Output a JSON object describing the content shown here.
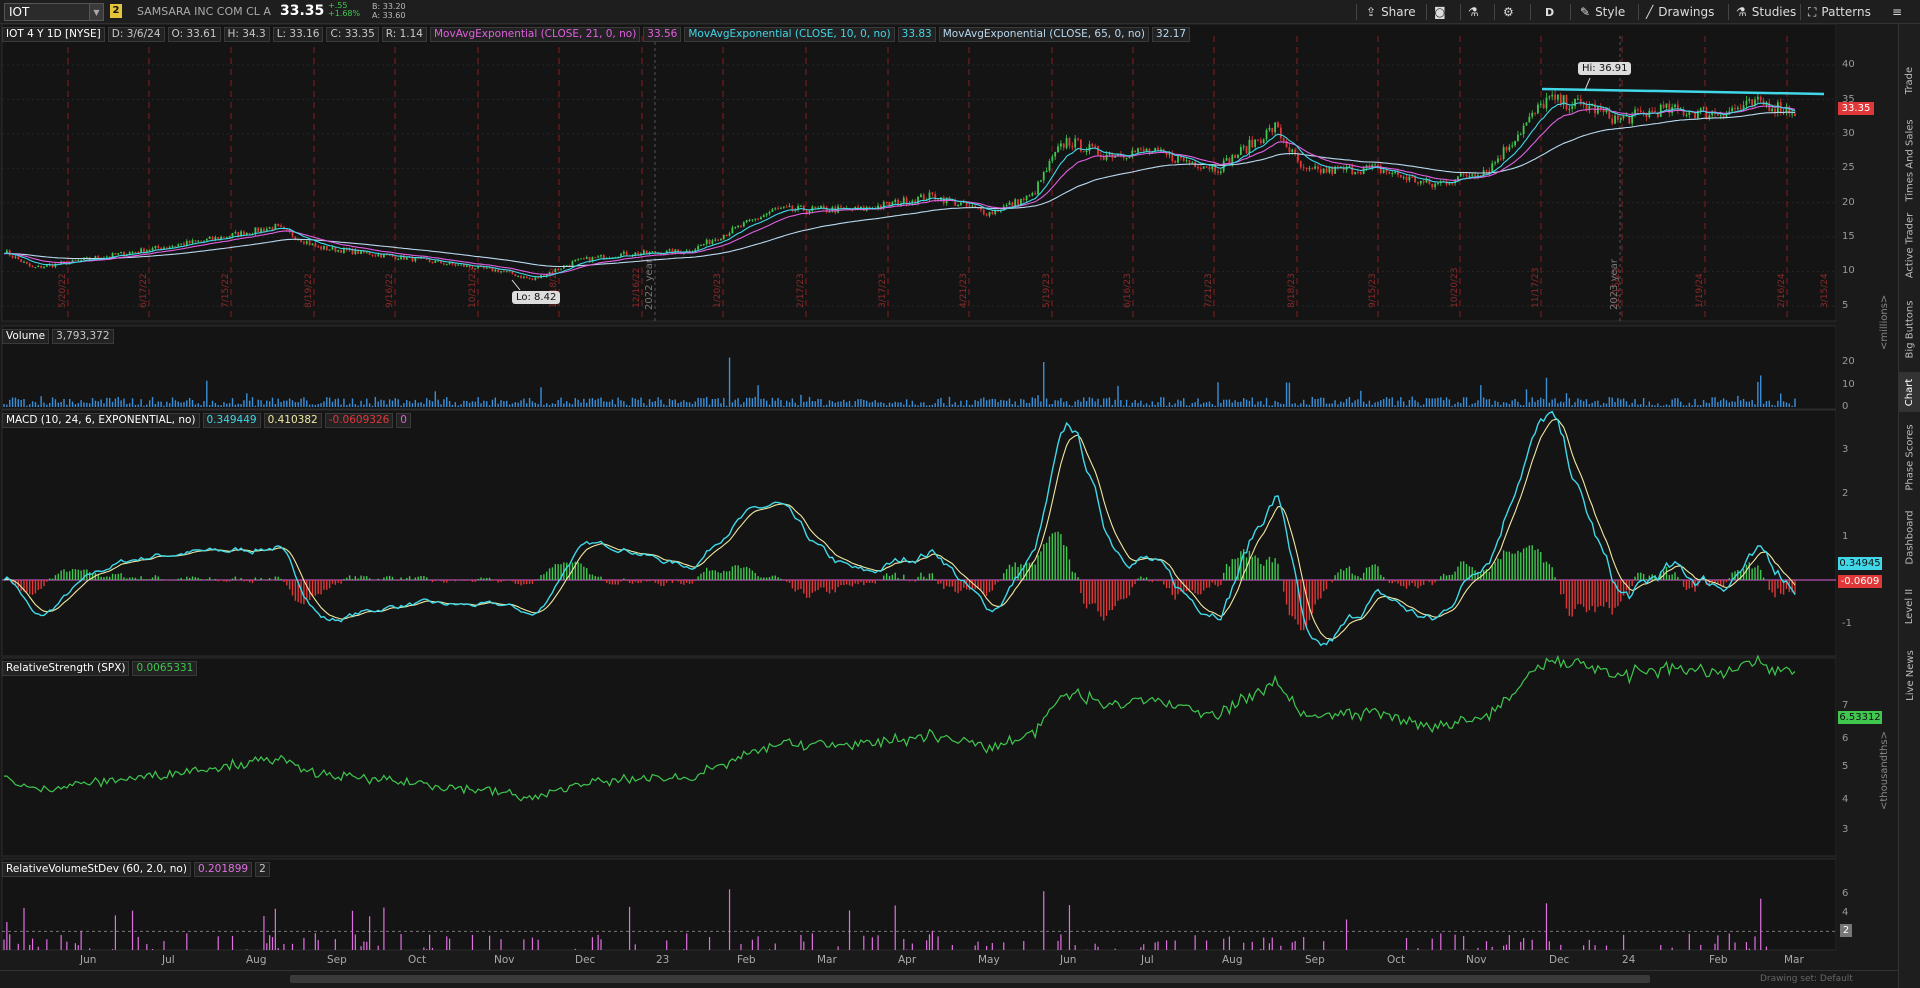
{
  "header": {
    "symbol": "IOT",
    "link_number": "2",
    "company": "SAMSARA INC COM CL A",
    "last": "33.35",
    "change": "+.55",
    "change_pct": "+1.68%",
    "bid": "B: 33.20",
    "ask": "A: 33.60",
    "timeframe": "D",
    "buttons": {
      "share": "Share",
      "style": "Style",
      "drawings": "Drawings",
      "studies": "Studies",
      "patterns": "Patterns"
    }
  },
  "side_tabs": [
    "Trade",
    "Times And Sales",
    "Active Trader",
    "Big Buttons",
    "Chart",
    "Phase Scores",
    "Dashboard",
    "Level II",
    "Live News"
  ],
  "price_panel": {
    "title": "IOT 4 Y 1D [NYSE]",
    "date": "D: 3/6/24",
    "open": "O: 33.61",
    "high": "H: 34.3",
    "low": "L: 33.16",
    "close": "C: 33.35",
    "range": "R: 1.14",
    "studies": [
      {
        "label": "MovAvgExponential (CLOSE, 21, 0, no)",
        "value": "33.56",
        "color": "#e060e0"
      },
      {
        "label": "MovAvgExponential (CLOSE, 10, 0, no)",
        "value": "33.83",
        "color": "#40d8e8"
      },
      {
        "label": "MovAvgExponential (CLOSE, 65, 0, no)",
        "value": "32.17",
        "color": "#b8d8f0"
      }
    ],
    "hi_label": "Hi: 36.91",
    "lo_label": "Lo: 8.42",
    "price_tag": "33.35",
    "y_ticks": [
      "40",
      "35",
      "30",
      "25",
      "20",
      "15",
      "10",
      "5"
    ],
    "year_markers": [
      "2022 year",
      "2023 year"
    ],
    "vertical_dates": [
      "5/20/22",
      "6/17/22",
      "7/15/22",
      "8/19/22",
      "9/16/22",
      "10/21/22",
      "11/18/22",
      "12/16/22",
      "1/20/23",
      "2/17/23",
      "3/17/23",
      "4/21/23",
      "5/19/23",
      "6/16/23",
      "7/21/23",
      "8/18/23",
      "9/15/23",
      "10/20/23",
      "11/17/23",
      "12/15/23",
      "1/19/24",
      "2/16/24",
      "3/15/24"
    ]
  },
  "volume_panel": {
    "title": "Volume",
    "value": "3,793,372",
    "y_ticks": [
      "20",
      "10",
      "0"
    ],
    "unit": "<millions>"
  },
  "macd_panel": {
    "title": "MACD (10, 24, 6, EXPONENTIAL, no)",
    "value": "0.349449",
    "avg": "0.410382",
    "diff": "-0.0609326",
    "zero": "0",
    "y_ticks": [
      "3",
      "2",
      "1",
      "-1"
    ],
    "tag_value": "0.34945",
    "tag_diff": "-0.0609"
  },
  "rs_panel": {
    "title": "RelativeStrength (SPX)",
    "value": "0.0065331",
    "y_ticks": [
      "7",
      "6",
      "5",
      "4",
      "3"
    ],
    "tag": "6.53312",
    "unit": "<thousandths>"
  },
  "rvsd_panel": {
    "title": "RelativeVolumeStDev (60, 2.0, no)",
    "value": "0.201899",
    "threshold": "2",
    "y_ticks": [
      "6",
      "4",
      "2"
    ],
    "tag": "2"
  },
  "x_axis": [
    "Jun",
    "Jul",
    "Aug",
    "Sep",
    "Oct",
    "Nov",
    "Dec",
    "23",
    "Feb",
    "Mar",
    "Apr",
    "May",
    "Jun",
    "Jul",
    "Aug",
    "Sep",
    "Oct",
    "Nov",
    "Dec",
    "24",
    "Feb",
    "Mar"
  ],
  "status": "Drawing set: Default",
  "colors": {
    "price_up": "#3fc74f",
    "price_down": "#e03838",
    "ema21": "#e060e0",
    "ema10": "#40d8e8",
    "ema65": "#b8d8f0",
    "volume": "#3a8fd8",
    "macd": "#40d8e8",
    "signal": "#f0e8a0",
    "rs": "#3fc74f",
    "rvsd": "#e070e0",
    "trendline": "#40d8e8"
  }
}
